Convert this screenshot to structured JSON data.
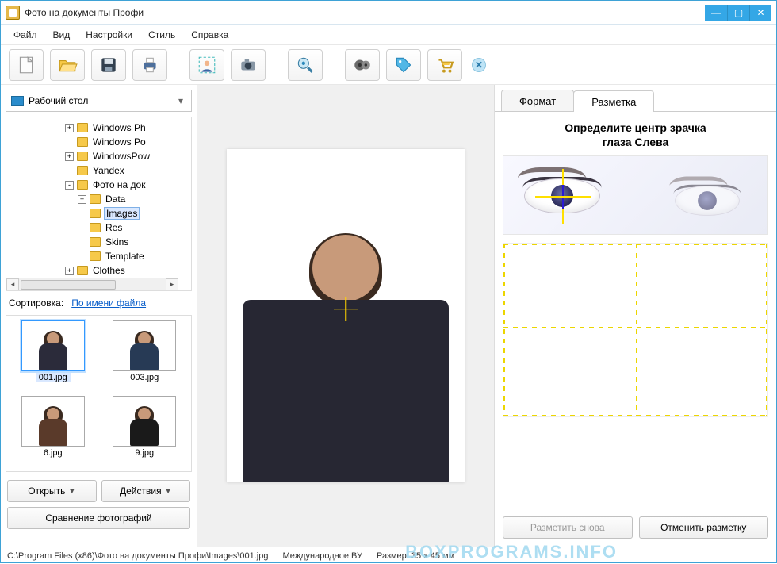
{
  "window": {
    "title": "Фото на документы Профи"
  },
  "menu": [
    "Файл",
    "Вид",
    "Настройки",
    "Стиль",
    "Справка"
  ],
  "toolbar_icons": [
    "new-doc",
    "open-folder",
    "save",
    "print",
    "crop-person",
    "camera",
    "zoom-search",
    "video",
    "tag",
    "shopping-cart"
  ],
  "location": {
    "label": "Рабочий стол"
  },
  "tree": [
    {
      "indent": 4,
      "expand": "+",
      "label": "Windows Ph"
    },
    {
      "indent": 4,
      "expand": "",
      "label": "Windows Po"
    },
    {
      "indent": 4,
      "expand": "+",
      "label": "WindowsPow"
    },
    {
      "indent": 4,
      "expand": "",
      "label": "Yandex"
    },
    {
      "indent": 4,
      "expand": "-",
      "label": "Фото на док"
    },
    {
      "indent": 5,
      "expand": "+",
      "label": "Data"
    },
    {
      "indent": 5,
      "expand": "",
      "label": "Images",
      "selected": true
    },
    {
      "indent": 5,
      "expand": "",
      "label": "Res"
    },
    {
      "indent": 5,
      "expand": "",
      "label": "Skins"
    },
    {
      "indent": 5,
      "expand": "",
      "label": "Template"
    },
    {
      "indent": 4,
      "expand": "+",
      "label": "Clothes"
    }
  ],
  "sort": {
    "label": "Сортировка:",
    "value": "По имени файла"
  },
  "thumbs": [
    {
      "name": "001.jpg",
      "selected": true
    },
    {
      "name": "003.jpg"
    },
    {
      "name": "6.jpg"
    },
    {
      "name": "9.jpg"
    }
  ],
  "left_buttons": {
    "open": "Открыть",
    "actions": "Действия",
    "compare": "Сравнение фотографий"
  },
  "right": {
    "tabs": {
      "format": "Формат",
      "markup": "Разметка"
    },
    "title_line1": "Определите центр зрачка",
    "title_line2": "глаза Слева",
    "btn_reset": "Разметить снова",
    "btn_cancel": "Отменить разметку"
  },
  "status": {
    "path": "C:\\Program Files (x86)\\Фото на документы Профи\\Images\\001.jpg",
    "mode": "Международное ВУ",
    "size": "Размер: 35 x 45 мм"
  },
  "watermark": "BOXPROGRAMS.INFO"
}
